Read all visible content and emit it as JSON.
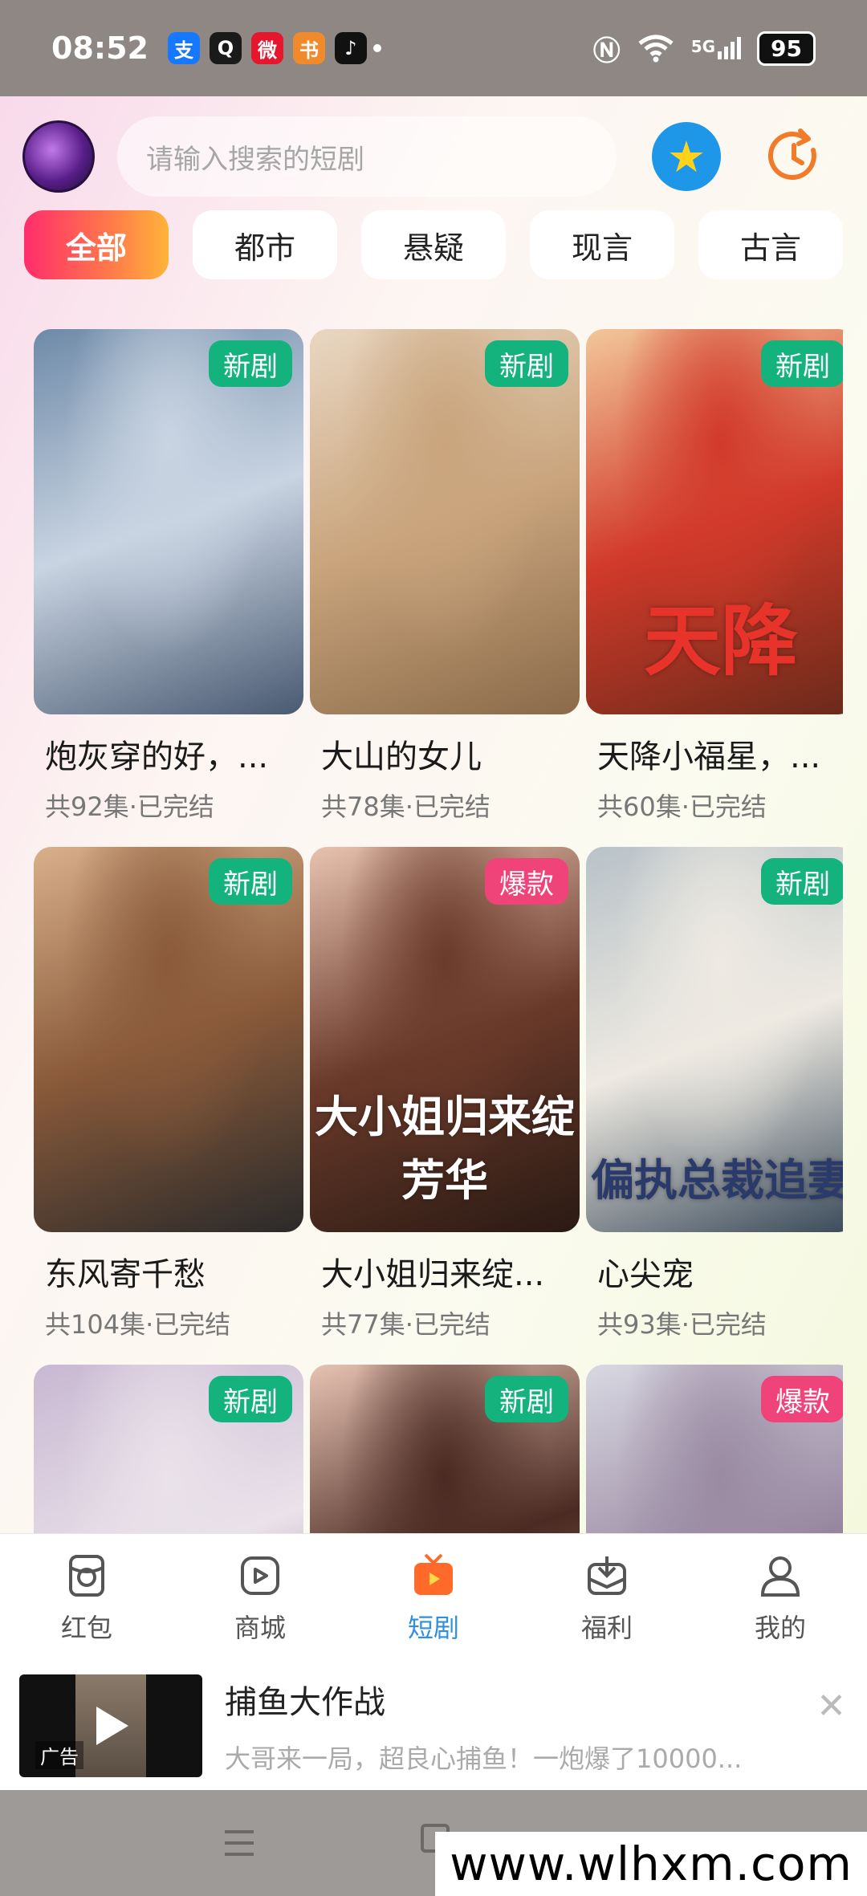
{
  "status_bar": {
    "time": "08:52",
    "notification_icons": [
      {
        "name": "alipay-icon",
        "glyph": "支",
        "color": "#1677ff"
      },
      {
        "name": "qq-icon",
        "glyph": "Q",
        "color": "#1a1a1a"
      },
      {
        "name": "weibo-icon",
        "glyph": "微",
        "color": "#e6162d"
      },
      {
        "name": "book-icon",
        "glyph": "书",
        "color": "#f08a2c"
      },
      {
        "name": "tiktok-icon",
        "glyph": "♪",
        "color": "#111111"
      }
    ],
    "network": "5G",
    "battery": "95"
  },
  "header": {
    "search_placeholder": "请输入搜索的短剧"
  },
  "tabs": [
    {
      "label": "全部",
      "active": true
    },
    {
      "label": "都市",
      "active": false
    },
    {
      "label": "悬疑",
      "active": false
    },
    {
      "label": "现言",
      "active": false
    },
    {
      "label": "古言",
      "active": false
    }
  ],
  "dramas": [
    {
      "title": "炮灰穿的好，...",
      "meta": "共92集·已完结",
      "badge": "新剧",
      "badge_type": "new",
      "colors": [
        "#6e8aa8",
        "#c9d4e2",
        "#4a5a72"
      ]
    },
    {
      "title": "大山的女儿",
      "meta": "共78集·已完结",
      "badge": "新剧",
      "badge_type": "new",
      "colors": [
        "#e9d7c2",
        "#c9a47c",
        "#8a6a4a"
      ]
    },
    {
      "title": "天降小福星，...",
      "meta": "共60集·已完结",
      "badge": "新剧",
      "badge_type": "new",
      "colors": [
        "#f2c79a",
        "#d23a2a",
        "#6a2a1a"
      ],
      "poster_text": "天降",
      "poster_text_color": "#e8332a"
    },
    {
      "title": "东风寄千愁",
      "meta": "共104集·已完结",
      "badge": "新剧",
      "badge_type": "new",
      "colors": [
        "#d8b08a",
        "#8a5a3a",
        "#2a2a2a"
      ]
    },
    {
      "title": "大小姐归来绽...",
      "meta": "共77集·已完结",
      "badge": "爆款",
      "badge_type": "hot",
      "colors": [
        "#e8c2b0",
        "#6a3a2a",
        "#2a1a14"
      ],
      "poster_text": "大小姐归来绽芳华",
      "poster_text_color": "#ffffff"
    },
    {
      "title": "心尖宠",
      "meta": "共93集·已完结",
      "badge": "新剧",
      "badge_type": "new",
      "colors": [
        "#b8c2c8",
        "#eeeae2",
        "#3a4a5a"
      ],
      "poster_text": "偏执总裁追妻",
      "poster_text_color": "#2a3a6a"
    },
    {
      "title": "",
      "meta": "",
      "badge": "新剧",
      "badge_type": "new",
      "colors": [
        "#c8b8d2",
        "#eae2ea",
        "#7a5a8a"
      ]
    },
    {
      "title": "",
      "meta": "",
      "badge": "新剧",
      "badge_type": "new",
      "colors": [
        "#e6c2b2",
        "#4a2a22",
        "#b28a7a"
      ]
    },
    {
      "title": "",
      "meta": "",
      "badge": "爆款",
      "badge_type": "hot",
      "colors": [
        "#d8d8e2",
        "#9a8aa2",
        "#4a4a5a"
      ]
    }
  ],
  "bottom_nav": [
    {
      "label": "红包",
      "icon": "red-packet-icon",
      "active": false
    },
    {
      "label": "商城",
      "icon": "mall-icon",
      "active": false
    },
    {
      "label": "短剧",
      "icon": "short-drama-icon",
      "active": true
    },
    {
      "label": "福利",
      "icon": "welfare-icon",
      "active": false
    },
    {
      "label": "我的",
      "icon": "profile-icon",
      "active": false
    }
  ],
  "ad": {
    "tag": "广告",
    "title": "捕鱼大作战",
    "description": "大哥来一局，超良心捕鱼！一炮爆了10000..."
  },
  "watermark": "www.wlhxm.com"
}
